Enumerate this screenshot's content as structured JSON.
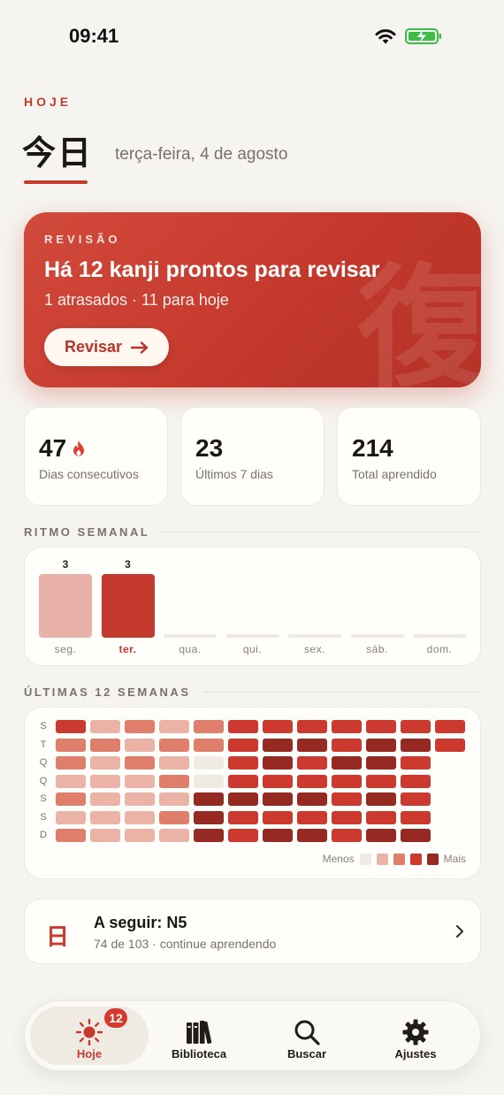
{
  "status_bar": {
    "time": "09:41",
    "wifi": "wifi-icon",
    "battery": "battery-charging-icon"
  },
  "header": {
    "eyebrow": "HOJE",
    "kanji_title": "今日",
    "date": "terça-feira, 4 de agosto"
  },
  "review_card": {
    "eyebrow": "REVISÃO",
    "title": "Há 12 kanji prontos para revisar",
    "subtitle": "1 atrasados · 11 para hoje",
    "button_label": "Revisar",
    "watermark": "復"
  },
  "stats": [
    {
      "value": "47",
      "label": "Dias consecutivos",
      "icon": "flame-icon"
    },
    {
      "value": "23",
      "label": "Últimos 7 dias"
    },
    {
      "value": "214",
      "label": "Total aprendido"
    }
  ],
  "weekly": {
    "title": "RITMO SEMANAL",
    "days": [
      {
        "label": "seg.",
        "count": "3",
        "value": 3,
        "current": false
      },
      {
        "label": "ter.",
        "count": "3",
        "value": 3,
        "current": true
      },
      {
        "label": "qua.",
        "count": "",
        "value": 0,
        "current": false
      },
      {
        "label": "qui.",
        "count": "",
        "value": 0,
        "current": false
      },
      {
        "label": "sex.",
        "count": "",
        "value": 0,
        "current": false
      },
      {
        "label": "sáb.",
        "count": "",
        "value": 0,
        "current": false
      },
      {
        "label": "dom.",
        "count": "",
        "value": 0,
        "current": false
      }
    ]
  },
  "heatmap": {
    "title": "ÚLTIMAS 12 SEMANAS",
    "row_labels": [
      "S",
      "T",
      "Q",
      "Q",
      "S",
      "S",
      "D"
    ],
    "levels_colors": [
      "#efebe2",
      "#ebb3a6",
      "#df7f6b",
      "#cc3a2f",
      "#962a22"
    ],
    "weeks": [
      [
        3,
        2,
        2,
        1,
        2,
        1,
        2
      ],
      [
        1,
        2,
        1,
        1,
        1,
        1,
        1
      ],
      [
        2,
        1,
        2,
        1,
        1,
        1,
        1
      ],
      [
        1,
        2,
        1,
        2,
        1,
        2,
        1
      ],
      [
        2,
        2,
        0,
        0,
        4,
        4,
        4
      ],
      [
        3,
        3,
        3,
        3,
        4,
        3,
        3
      ],
      [
        3,
        4,
        4,
        3,
        4,
        3,
        4
      ],
      [
        3,
        4,
        3,
        3,
        4,
        3,
        4
      ],
      [
        3,
        3,
        4,
        3,
        3,
        3,
        3
      ],
      [
        3,
        4,
        4,
        3,
        4,
        3,
        4
      ],
      [
        3,
        4,
        3,
        3,
        3,
        3,
        4
      ],
      [
        3,
        3,
        null,
        null,
        null,
        null,
        null
      ]
    ],
    "legend_less": "Menos",
    "legend_more": "Mais"
  },
  "next_card": {
    "kanji": "日",
    "title": "A seguir: N5",
    "subtitle": "74 de 103 · continue aprendendo"
  },
  "tab_bar": {
    "tabs": [
      {
        "label": "Hoje",
        "icon": "sun-icon",
        "active": true,
        "badge": "12"
      },
      {
        "label": "Biblioteca",
        "icon": "books-icon",
        "active": false
      },
      {
        "label": "Buscar",
        "icon": "search-icon",
        "active": false
      },
      {
        "label": "Ajustes",
        "icon": "gear-icon",
        "active": false
      }
    ]
  },
  "colors": {
    "accent": "#c53a2e",
    "light_bar": "#e9b1a7",
    "background": "#f6f4f0"
  }
}
